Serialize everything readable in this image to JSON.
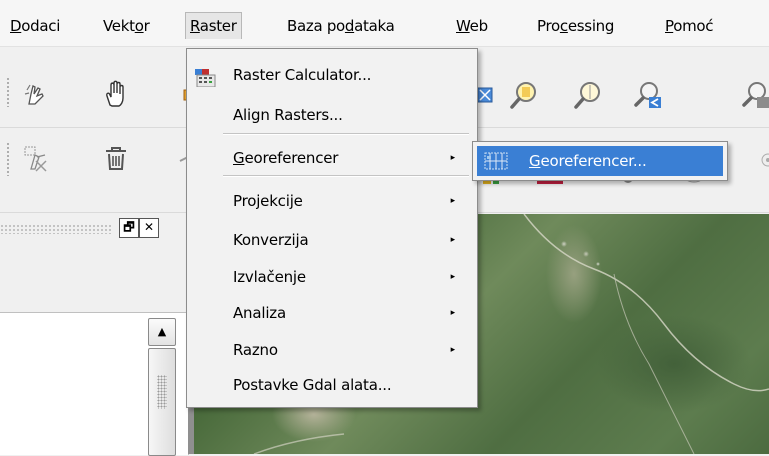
{
  "menubar": {
    "items": [
      {
        "pre": "",
        "ul": "D",
        "post": "odaci"
      },
      {
        "pre": "Vekt",
        "ul": "o",
        "post": "r"
      },
      {
        "pre": "",
        "ul": "R",
        "post": "aster"
      },
      {
        "pre": "Baza po",
        "ul": "d",
        "post": "ataka"
      },
      {
        "pre": "",
        "ul": "W",
        "post": "eb"
      },
      {
        "pre": "Pro",
        "ul": "c",
        "post": "essing"
      },
      {
        "pre": "",
        "ul": "P",
        "post": "omoć"
      }
    ]
  },
  "raster_menu": {
    "items": [
      {
        "pre": "Raster Calculator...",
        "ul": "",
        "post": ""
      },
      {
        "pre": "Align Rasters...",
        "ul": "",
        "post": ""
      },
      {
        "pre": "",
        "ul": "G",
        "post": "eoreferencer"
      },
      {
        "pre": "Projekcije",
        "ul": "",
        "post": ""
      },
      {
        "pre": "Konverzija",
        "ul": "",
        "post": ""
      },
      {
        "pre": "Izvlačenje",
        "ul": "",
        "post": ""
      },
      {
        "pre": "Analiza",
        "ul": "",
        "post": ""
      },
      {
        "pre": "Razno",
        "ul": "",
        "post": ""
      },
      {
        "pre": "Postavke Gdal alata...",
        "ul": "",
        "post": ""
      }
    ],
    "submenu_arrow": "▸"
  },
  "georeferencer_submenu": {
    "item": {
      "pre": "",
      "ul": "G",
      "post": "eoreferencer..."
    }
  },
  "panel": {
    "float_glyph": "🗗",
    "close_glyph": "✕",
    "scroll_up_glyph": "▲"
  },
  "colors": {
    "highlight": "#3a7fd4",
    "menu_bg": "#f2f2f2"
  }
}
